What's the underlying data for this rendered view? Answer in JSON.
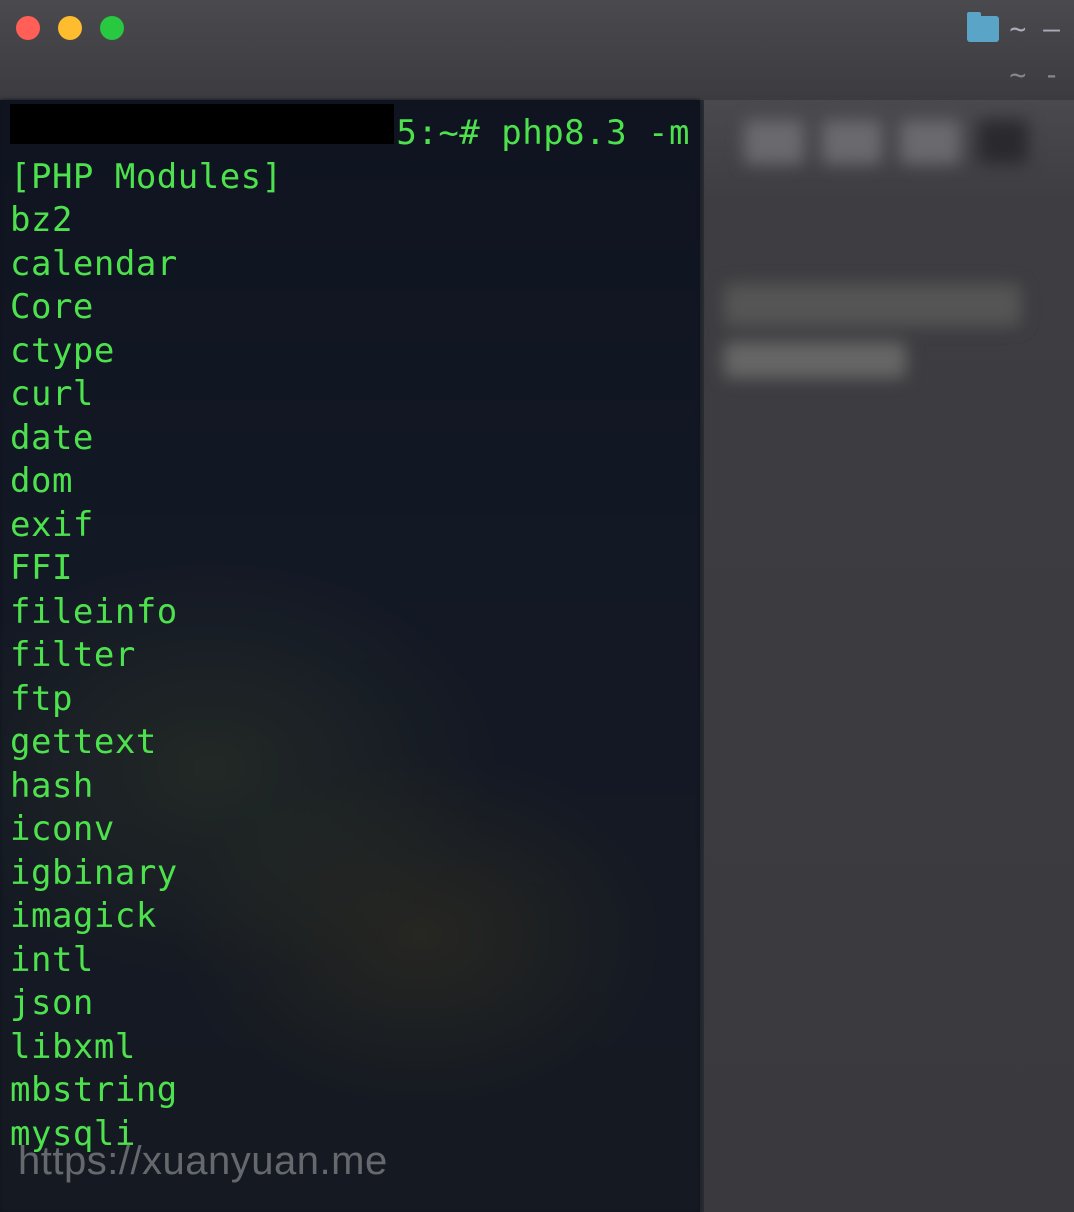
{
  "titlebar": {
    "right_label": "~ —",
    "right_lower": "~ -"
  },
  "terminal": {
    "prompt_suffix": "5:~#",
    "command": "php8.3 -m",
    "header": "[PHP Modules]",
    "modules": [
      "bz2",
      "calendar",
      "Core",
      "ctype",
      "curl",
      "date",
      "dom",
      "exif",
      "FFI",
      "fileinfo",
      "filter",
      "ftp",
      "gettext",
      "hash",
      "iconv",
      "igbinary",
      "imagick",
      "intl",
      "json",
      "libxml",
      "mbstring",
      "mysqli"
    ]
  },
  "watermark": "https://xuanyuan.me"
}
